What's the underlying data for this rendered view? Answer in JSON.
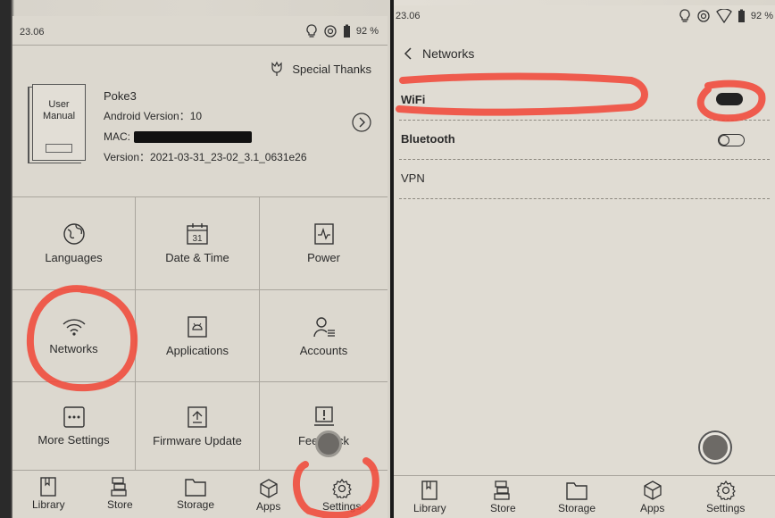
{
  "left": {
    "status_bar": {
      "time": "23.06",
      "battery": "92 %"
    },
    "special_thanks": "Special Thanks",
    "manual_label": "User Manual",
    "device": {
      "name": "Poke3",
      "android_version": "Android Version：10",
      "mac_label": "MAC:",
      "version": "Version：2021-03-31_23-02_3.1_0631e26"
    },
    "tiles": [
      {
        "label": "Languages",
        "icon": "globe-icon"
      },
      {
        "label": "Date & Time",
        "icon": "calendar-icon",
        "calendar_day": "31"
      },
      {
        "label": "Power",
        "icon": "power-chart-icon"
      },
      {
        "label": "Networks",
        "icon": "wifi-icon"
      },
      {
        "label": "Applications",
        "icon": "android-icon"
      },
      {
        "label": "Accounts",
        "icon": "account-icon"
      },
      {
        "label": "More Settings",
        "icon": "more-icon"
      },
      {
        "label": "Firmware Update",
        "icon": "upload-icon"
      },
      {
        "label": "Feedback",
        "icon": "feedback-icon"
      }
    ],
    "nav": [
      "Library",
      "Store",
      "Storage",
      "Apps",
      "Settings"
    ]
  },
  "right": {
    "status_bar": {
      "time": "23.06",
      "battery": "92 %"
    },
    "header_title": "Networks",
    "items": [
      {
        "label": "WiFi",
        "toggle": true
      },
      {
        "label": "Bluetooth",
        "toggle": false
      },
      {
        "label": "VPN"
      }
    ],
    "nav": [
      "Library",
      "Store",
      "Storage",
      "Apps",
      "Settings"
    ]
  },
  "colors": {
    "annotation_red": "#f0493a",
    "screen_bg": "#dcd8cf",
    "divider": "#a9a59d"
  }
}
